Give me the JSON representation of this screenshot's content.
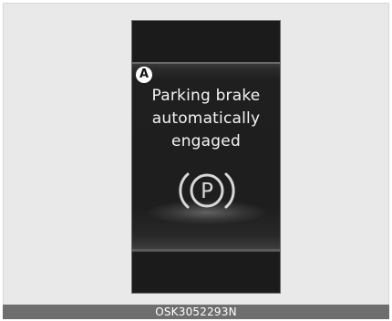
{
  "display": {
    "marker_label": "A",
    "message_lines": [
      "Parking brake",
      "automatically",
      "engaged"
    ],
    "icon": "parking-brake-icon",
    "icon_letter": "P"
  },
  "caption": {
    "code": "OSK3052293N"
  },
  "colors": {
    "display_background": "#1b1b1b",
    "text": "#f4f4f4",
    "caption_bar": "#6e6e6e",
    "frame_background": "#e9e9e9"
  }
}
